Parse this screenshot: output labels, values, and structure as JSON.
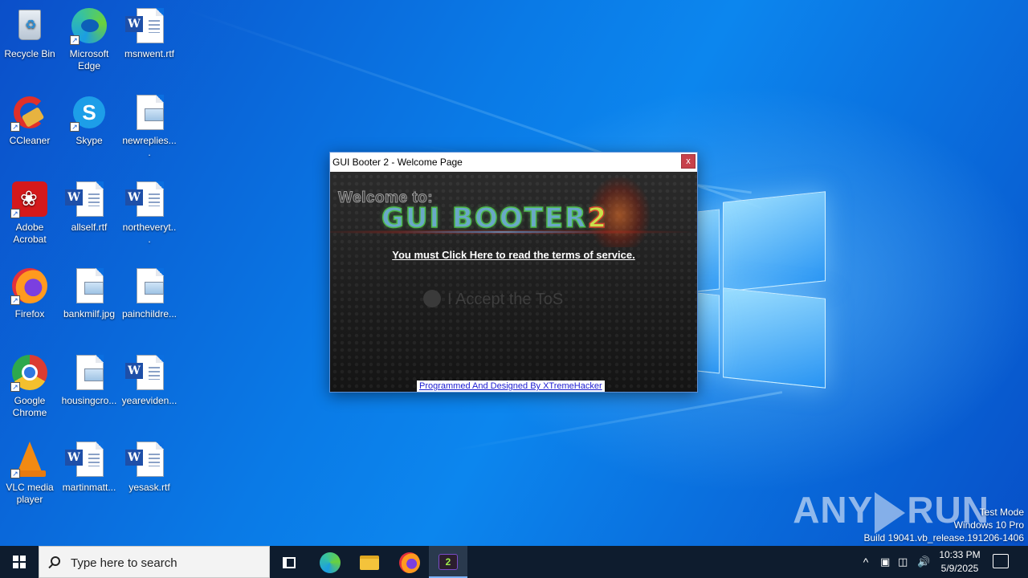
{
  "desktop": {
    "icons": [
      {
        "label": "Recycle Bin",
        "icon": "recycle-bin-icon"
      },
      {
        "label": "Microsoft Edge",
        "icon": "edge-icon"
      },
      {
        "label": "msnwent.rtf",
        "icon": "word-doc-icon"
      },
      {
        "label": "CCleaner",
        "icon": "ccleaner-icon"
      },
      {
        "label": "Skype",
        "icon": "skype-icon"
      },
      {
        "label": "newreplies....",
        "icon": "image-file-icon"
      },
      {
        "label": "Adobe Acrobat",
        "icon": "acrobat-icon"
      },
      {
        "label": "allself.rtf",
        "icon": "word-doc-icon"
      },
      {
        "label": "northeveryt...",
        "icon": "word-doc-icon"
      },
      {
        "label": "Firefox",
        "icon": "firefox-icon"
      },
      {
        "label": "bankmilf.jpg",
        "icon": "image-file-icon"
      },
      {
        "label": "painchildre...",
        "icon": "image-file-icon"
      },
      {
        "label": "Google Chrome",
        "icon": "chrome-icon"
      },
      {
        "label": "housingcro...",
        "icon": "image-file-icon"
      },
      {
        "label": "yeareviden...",
        "icon": "word-doc-icon"
      },
      {
        "label": "VLC media player",
        "icon": "vlc-icon"
      },
      {
        "label": "martinmatt...",
        "icon": "word-doc-icon"
      },
      {
        "label": "yesask.rtf",
        "icon": "word-doc-icon"
      }
    ]
  },
  "app_window": {
    "title": "GUI Booter 2  -  Welcome Page",
    "close_label": "x",
    "welcome_text": "Welcome to:",
    "logo_main": "GUI BOOTER",
    "logo_num": "2",
    "tos_link": "You must Click Here to read the terms of service.",
    "accept_label": "I Accept the ToS",
    "credit_link": "Programmed And Designed By XTremeHacker"
  },
  "watermark": {
    "text_left": "ANY",
    "text_right": "RUN"
  },
  "system_info": {
    "line1": "Test Mode",
    "line2": "Windows 10 Pro",
    "line3": "Build 19041.vb_release.191206-1406"
  },
  "taskbar": {
    "search_placeholder": "Type here to search",
    "pinned": [
      "task-view-icon",
      "edge-icon",
      "file-explorer-icon",
      "firefox-icon",
      "gui-booter-icon"
    ],
    "clock_time": "10:33 PM",
    "clock_date": "5/9/2025",
    "tray_chevron": "^"
  },
  "colors": {
    "taskbar": "#0e1c2e",
    "close_button": "#c7414b",
    "desktop_blue": "#0a66d6"
  }
}
